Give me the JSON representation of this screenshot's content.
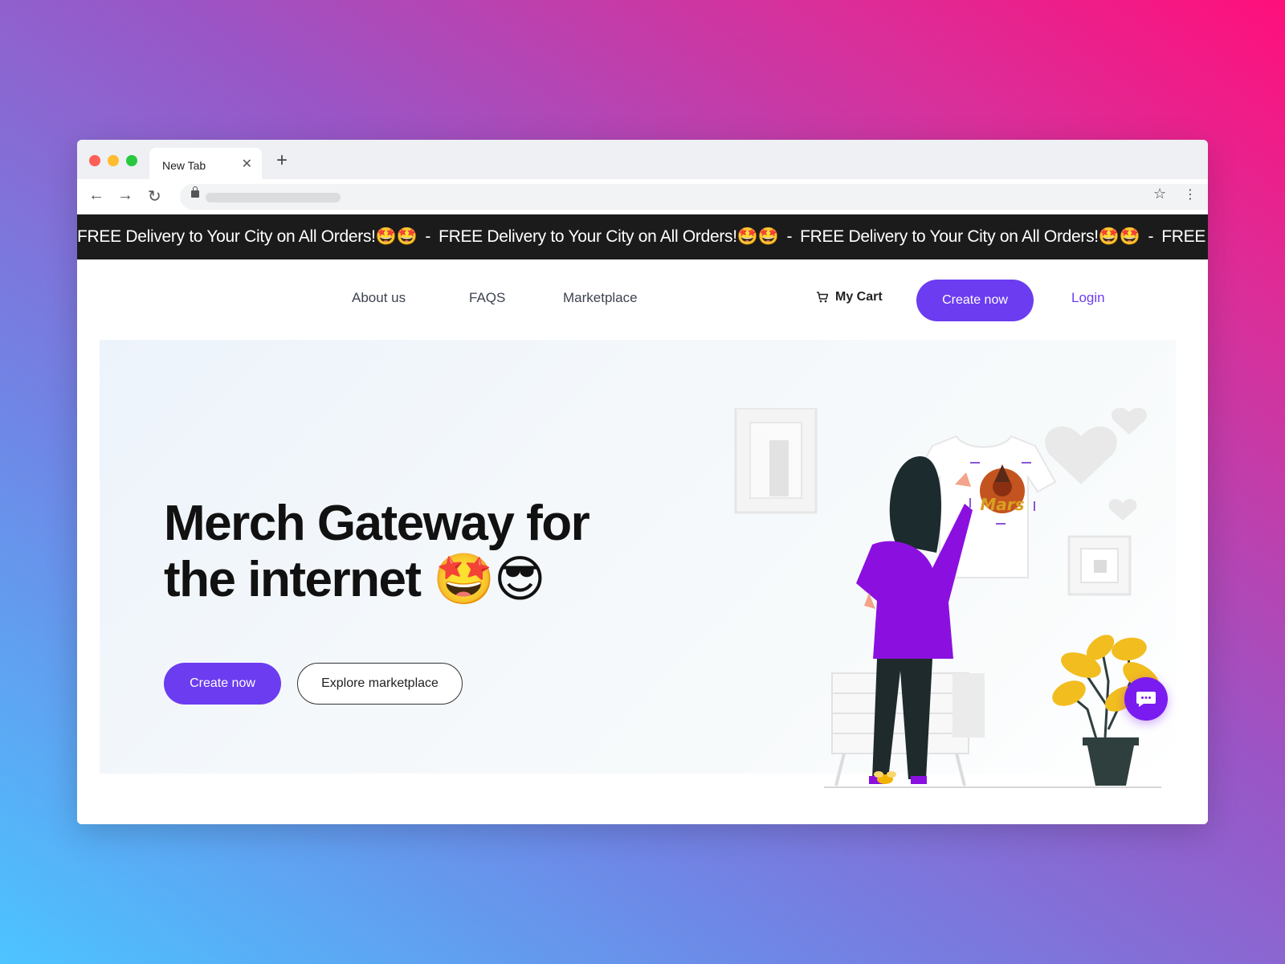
{
  "browser": {
    "tab_title": "New Tab",
    "tab_close": "✕",
    "new_tab": "+",
    "nav_back": "←",
    "nav_forward": "→",
    "nav_reload": "↻",
    "bookmark": "☆",
    "menu": "⋮"
  },
  "ticker": {
    "message": "FREE Delivery to Your City on All Orders!🤩🤩",
    "separator": "-",
    "partial": "FREE De"
  },
  "nav": {
    "links": [
      "About us",
      "FAQS",
      "Marketplace"
    ],
    "cart_label": "My Cart",
    "create_label": "Create now",
    "login_label": "Login"
  },
  "hero": {
    "headline_line1": "Merch Gateway for",
    "headline_line2": "the internet 🤩😎",
    "cta_primary": "Create now",
    "cta_secondary": "Explore marketplace",
    "shirt_text": "Mars"
  },
  "colors": {
    "accent": "#6c3cf0",
    "ticker_bg": "#1b1b1b",
    "chat_bg": "#7a1cf0"
  }
}
